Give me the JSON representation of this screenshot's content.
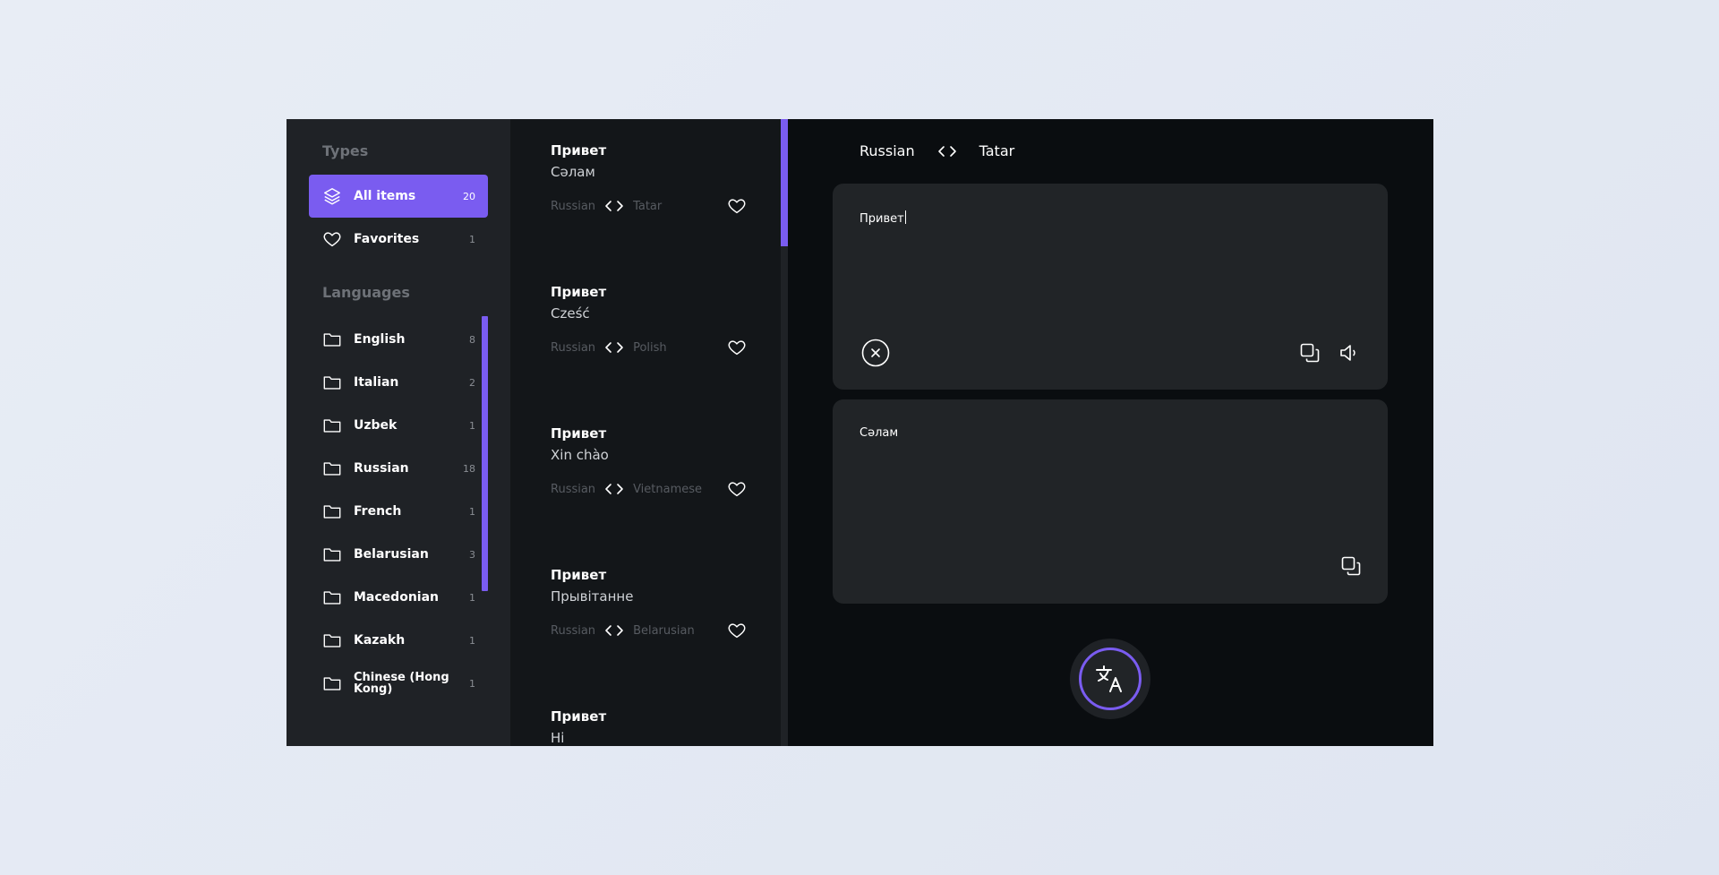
{
  "sidebar": {
    "types_title": "Types",
    "types": [
      {
        "label": "All items",
        "count": "20",
        "icon": "layers-icon",
        "active": true
      },
      {
        "label": "Favorites",
        "count": "1",
        "icon": "heart-icon",
        "active": false
      }
    ],
    "languages_title": "Languages",
    "languages": [
      {
        "label": "English",
        "count": "8"
      },
      {
        "label": "Italian",
        "count": "2"
      },
      {
        "label": "Uzbek",
        "count": "1"
      },
      {
        "label": "Russian",
        "count": "18"
      },
      {
        "label": "French",
        "count": "1"
      },
      {
        "label": "Belarusian",
        "count": "3"
      },
      {
        "label": "Macedonian",
        "count": "1"
      },
      {
        "label": "Kazakh",
        "count": "1"
      },
      {
        "label": "Chinese (Hong Kong)",
        "count": "1"
      }
    ]
  },
  "history": [
    {
      "source": "Привет",
      "target": "Сәлам",
      "from": "Russian",
      "to": "Tatar"
    },
    {
      "source": "Привет",
      "target": "Cześć",
      "from": "Russian",
      "to": "Polish"
    },
    {
      "source": "Привет",
      "target": "Xin chào",
      "from": "Russian",
      "to": "Vietnamese"
    },
    {
      "source": "Привет",
      "target": "Прывітанне",
      "from": "Russian",
      "to": "Belarusian"
    },
    {
      "source": "Привет",
      "target": "Hi",
      "from": "",
      "to": ""
    }
  ],
  "translator": {
    "from_lang": "Russian",
    "to_lang": "Tatar",
    "input_text": "Привет",
    "output_text": "Сәлам"
  },
  "colors": {
    "accent": "#7a5cf0",
    "sidebar_bg": "#1f2226",
    "list_bg": "#131619",
    "main_bg": "#0a0d10",
    "panel_bg": "#212427"
  }
}
